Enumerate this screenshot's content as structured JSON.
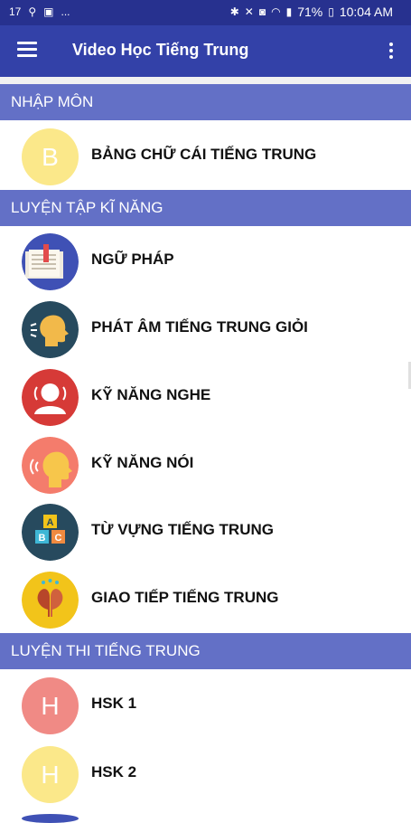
{
  "status_bar": {
    "left_icons": [
      "17",
      "usb-icon",
      "image-icon",
      "..."
    ],
    "battery": "71%",
    "time": "10:04 AM"
  },
  "app_bar": {
    "title": "Video Học Tiếng Trung"
  },
  "sections": [
    {
      "title": "NHẬP MÔN",
      "items": [
        {
          "label": "BẢNG CHỮ CÁI TIẾNG TRUNG",
          "icon": "letter-b-icon",
          "letter": "B",
          "color": "#fbe88a"
        }
      ]
    },
    {
      "title": "LUYỆN TẬP KĨ NĂNG",
      "items": [
        {
          "label": "NGỮ PHÁP",
          "icon": "book-icon",
          "color": "#3f51b5"
        },
        {
          "label": "PHÁT ÂM TIẾNG TRUNG GIỎI",
          "icon": "speaking-head-icon",
          "color": "#274a5e"
        },
        {
          "label": "KỸ NĂNG NGHE",
          "icon": "listening-icon",
          "color": "#d63a37"
        },
        {
          "label": "KỸ NĂNG NÓI",
          "icon": "talking-head-icon",
          "color": "#f47c6c"
        },
        {
          "label": "TỪ VỰNG TIẾNG TRUNG",
          "icon": "abc-blocks-icon",
          "color": "#274a5e"
        },
        {
          "label": "GIAO TIẾP TIẾNG TRUNG",
          "icon": "conversation-icon",
          "color": "#f2c41a"
        }
      ]
    },
    {
      "title": "LUYỆN THI TIẾNG TRUNG",
      "items": [
        {
          "label": "HSK 1",
          "icon": "letter-h-icon",
          "letter": "H",
          "color": "#f08a85"
        },
        {
          "label": "HSK 2",
          "icon": "letter-h-icon",
          "letter": "H",
          "color": "#fbe88a"
        }
      ]
    }
  ]
}
